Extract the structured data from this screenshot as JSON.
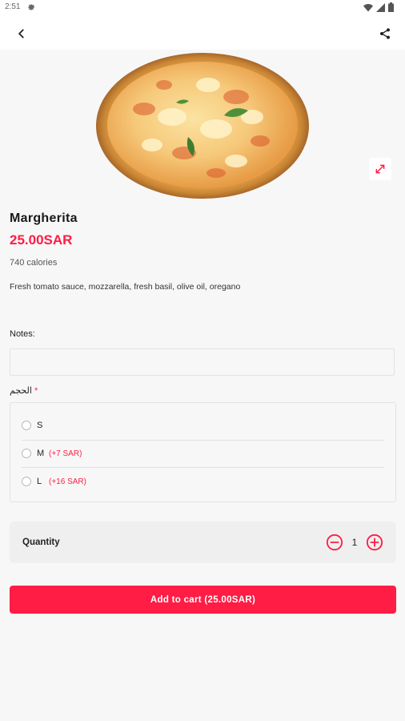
{
  "status_bar": {
    "time": "2:51"
  },
  "product": {
    "name": "Margherita",
    "price": "25.00SAR",
    "calories": "740 calories",
    "description": "Fresh tomato sauce, mozzarella, fresh basil, olive oil, oregano"
  },
  "notes": {
    "label": "Notes:",
    "value": "",
    "placeholder": ""
  },
  "size": {
    "label": "الحجم",
    "required_mark": "*",
    "options": [
      {
        "name": "S",
        "extra": "",
        "selected": false
      },
      {
        "name": "M",
        "extra": "(+7 SAR)",
        "selected": false
      },
      {
        "name": "L",
        "extra": "(+16 SAR)",
        "selected": false
      }
    ]
  },
  "quantity": {
    "label": "Quantity",
    "value": "1"
  },
  "add_to_cart": {
    "label": "Add to cart (25.00SAR)"
  },
  "colors": {
    "accent": "#ff1c45",
    "background": "#f7f7f7"
  },
  "icons": [
    "settings-icon",
    "wifi-icon",
    "signal-icon",
    "battery-icon",
    "back-arrow-icon",
    "share-icon",
    "expand-icon",
    "minus-circle-icon",
    "plus-circle-icon"
  ]
}
